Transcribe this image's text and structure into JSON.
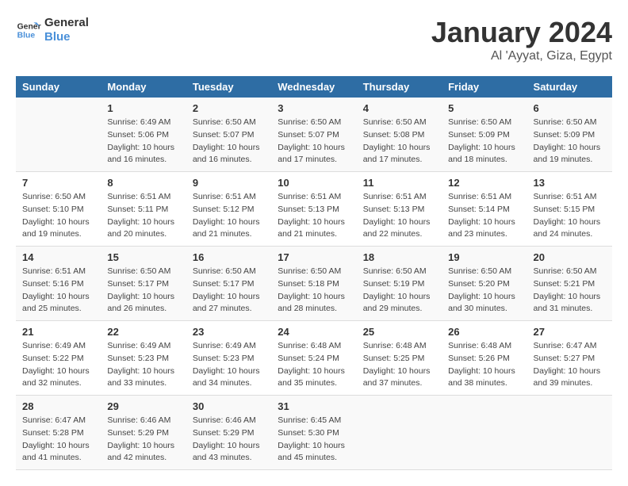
{
  "header": {
    "logo_line1": "General",
    "logo_line2": "Blue",
    "month": "January 2024",
    "location": "Al 'Ayyat, Giza, Egypt"
  },
  "days_of_week": [
    "Sunday",
    "Monday",
    "Tuesday",
    "Wednesday",
    "Thursday",
    "Friday",
    "Saturday"
  ],
  "weeks": [
    [
      {
        "num": "",
        "sunrise": "",
        "sunset": "",
        "daylight": ""
      },
      {
        "num": "1",
        "sunrise": "6:49 AM",
        "sunset": "5:06 PM",
        "daylight": "10 hours and 16 minutes."
      },
      {
        "num": "2",
        "sunrise": "6:50 AM",
        "sunset": "5:07 PM",
        "daylight": "10 hours and 16 minutes."
      },
      {
        "num": "3",
        "sunrise": "6:50 AM",
        "sunset": "5:07 PM",
        "daylight": "10 hours and 17 minutes."
      },
      {
        "num": "4",
        "sunrise": "6:50 AM",
        "sunset": "5:08 PM",
        "daylight": "10 hours and 17 minutes."
      },
      {
        "num": "5",
        "sunrise": "6:50 AM",
        "sunset": "5:09 PM",
        "daylight": "10 hours and 18 minutes."
      },
      {
        "num": "6",
        "sunrise": "6:50 AM",
        "sunset": "5:09 PM",
        "daylight": "10 hours and 19 minutes."
      }
    ],
    [
      {
        "num": "7",
        "sunrise": "6:50 AM",
        "sunset": "5:10 PM",
        "daylight": "10 hours and 19 minutes."
      },
      {
        "num": "8",
        "sunrise": "6:51 AM",
        "sunset": "5:11 PM",
        "daylight": "10 hours and 20 minutes."
      },
      {
        "num": "9",
        "sunrise": "6:51 AM",
        "sunset": "5:12 PM",
        "daylight": "10 hours and 21 minutes."
      },
      {
        "num": "10",
        "sunrise": "6:51 AM",
        "sunset": "5:13 PM",
        "daylight": "10 hours and 21 minutes."
      },
      {
        "num": "11",
        "sunrise": "6:51 AM",
        "sunset": "5:13 PM",
        "daylight": "10 hours and 22 minutes."
      },
      {
        "num": "12",
        "sunrise": "6:51 AM",
        "sunset": "5:14 PM",
        "daylight": "10 hours and 23 minutes."
      },
      {
        "num": "13",
        "sunrise": "6:51 AM",
        "sunset": "5:15 PM",
        "daylight": "10 hours and 24 minutes."
      }
    ],
    [
      {
        "num": "14",
        "sunrise": "6:51 AM",
        "sunset": "5:16 PM",
        "daylight": "10 hours and 25 minutes."
      },
      {
        "num": "15",
        "sunrise": "6:50 AM",
        "sunset": "5:17 PM",
        "daylight": "10 hours and 26 minutes."
      },
      {
        "num": "16",
        "sunrise": "6:50 AM",
        "sunset": "5:17 PM",
        "daylight": "10 hours and 27 minutes."
      },
      {
        "num": "17",
        "sunrise": "6:50 AM",
        "sunset": "5:18 PM",
        "daylight": "10 hours and 28 minutes."
      },
      {
        "num": "18",
        "sunrise": "6:50 AM",
        "sunset": "5:19 PM",
        "daylight": "10 hours and 29 minutes."
      },
      {
        "num": "19",
        "sunrise": "6:50 AM",
        "sunset": "5:20 PM",
        "daylight": "10 hours and 30 minutes."
      },
      {
        "num": "20",
        "sunrise": "6:50 AM",
        "sunset": "5:21 PM",
        "daylight": "10 hours and 31 minutes."
      }
    ],
    [
      {
        "num": "21",
        "sunrise": "6:49 AM",
        "sunset": "5:22 PM",
        "daylight": "10 hours and 32 minutes."
      },
      {
        "num": "22",
        "sunrise": "6:49 AM",
        "sunset": "5:23 PM",
        "daylight": "10 hours and 33 minutes."
      },
      {
        "num": "23",
        "sunrise": "6:49 AM",
        "sunset": "5:23 PM",
        "daylight": "10 hours and 34 minutes."
      },
      {
        "num": "24",
        "sunrise": "6:48 AM",
        "sunset": "5:24 PM",
        "daylight": "10 hours and 35 minutes."
      },
      {
        "num": "25",
        "sunrise": "6:48 AM",
        "sunset": "5:25 PM",
        "daylight": "10 hours and 37 minutes."
      },
      {
        "num": "26",
        "sunrise": "6:48 AM",
        "sunset": "5:26 PM",
        "daylight": "10 hours and 38 minutes."
      },
      {
        "num": "27",
        "sunrise": "6:47 AM",
        "sunset": "5:27 PM",
        "daylight": "10 hours and 39 minutes."
      }
    ],
    [
      {
        "num": "28",
        "sunrise": "6:47 AM",
        "sunset": "5:28 PM",
        "daylight": "10 hours and 41 minutes."
      },
      {
        "num": "29",
        "sunrise": "6:46 AM",
        "sunset": "5:29 PM",
        "daylight": "10 hours and 42 minutes."
      },
      {
        "num": "30",
        "sunrise": "6:46 AM",
        "sunset": "5:29 PM",
        "daylight": "10 hours and 43 minutes."
      },
      {
        "num": "31",
        "sunrise": "6:45 AM",
        "sunset": "5:30 PM",
        "daylight": "10 hours and 45 minutes."
      },
      {
        "num": "",
        "sunrise": "",
        "sunset": "",
        "daylight": ""
      },
      {
        "num": "",
        "sunrise": "",
        "sunset": "",
        "daylight": ""
      },
      {
        "num": "",
        "sunrise": "",
        "sunset": "",
        "daylight": ""
      }
    ]
  ],
  "labels": {
    "sunrise_prefix": "Sunrise: ",
    "sunset_prefix": "Sunset: ",
    "daylight_prefix": "Daylight: "
  }
}
